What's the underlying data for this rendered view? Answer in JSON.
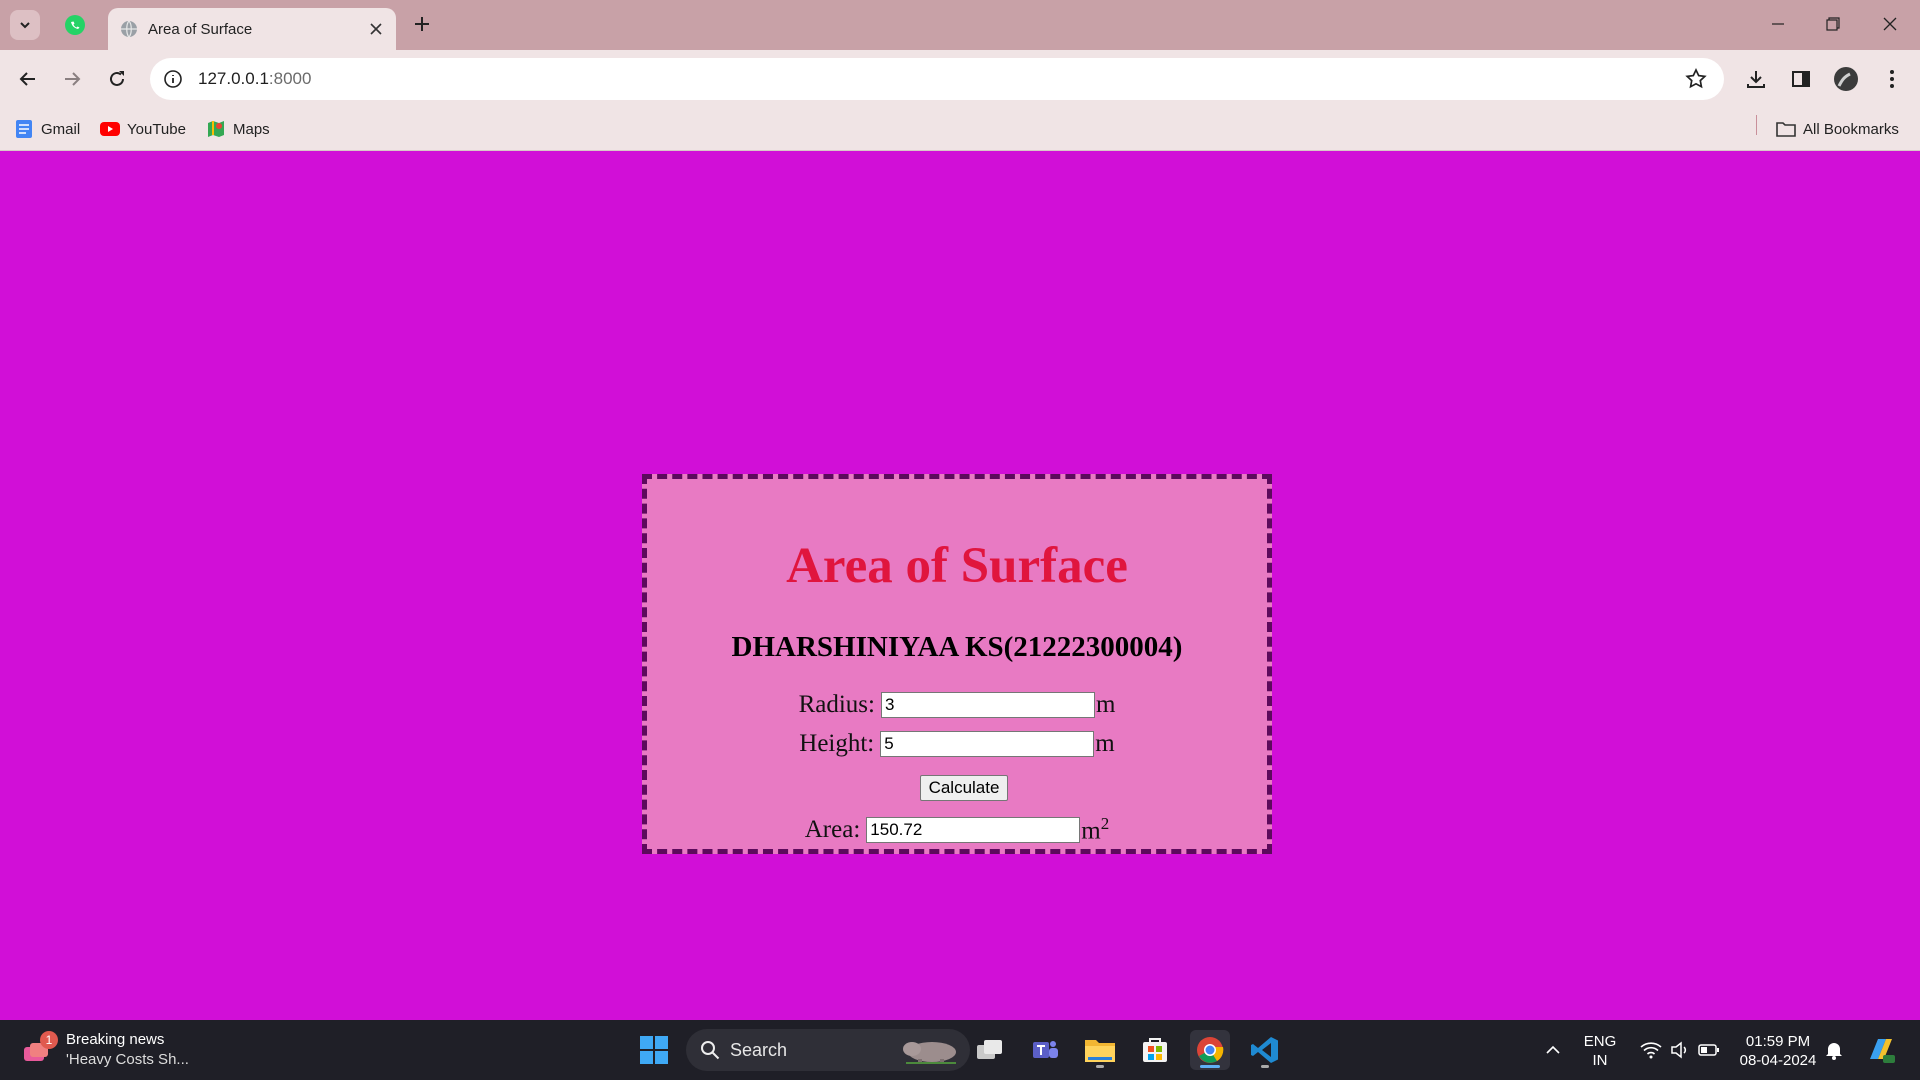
{
  "browser": {
    "tab_title": "Area of Surface",
    "url_host": "127.0.0.1",
    "url_port": ":8000",
    "bookmarks": [
      {
        "label": "Gmail",
        "icon": "gmail-icon"
      },
      {
        "label": "YouTube",
        "icon": "youtube-icon"
      },
      {
        "label": "Maps",
        "icon": "maps-icon"
      }
    ],
    "all_bookmarks": "All Bookmarks"
  },
  "page": {
    "heading": "Area of Surface",
    "author": "DHARSHINIYAA KS(21222300004)",
    "radius_label": "Radius:",
    "radius_value": "3",
    "radius_unit": "m",
    "height_label": "Height:",
    "height_value": "5",
    "height_unit": "m",
    "calculate_label": "Calculate",
    "area_label": "Area:",
    "area_value": "150.72",
    "area_unit": "m",
    "area_unit_exp": "2",
    "colors": {
      "background": "#d10fd7",
      "card": "#e87ac3",
      "heading": "#e0153e",
      "border": "#5c0a5c"
    }
  },
  "taskbar": {
    "news_badge": "1",
    "news_title": "Breaking news",
    "news_sub": "'Heavy Costs Sh...",
    "search_label": "Search",
    "lang_top": "ENG",
    "lang_bottom": "IN",
    "time": "01:59 PM",
    "date": "08-04-2024"
  }
}
